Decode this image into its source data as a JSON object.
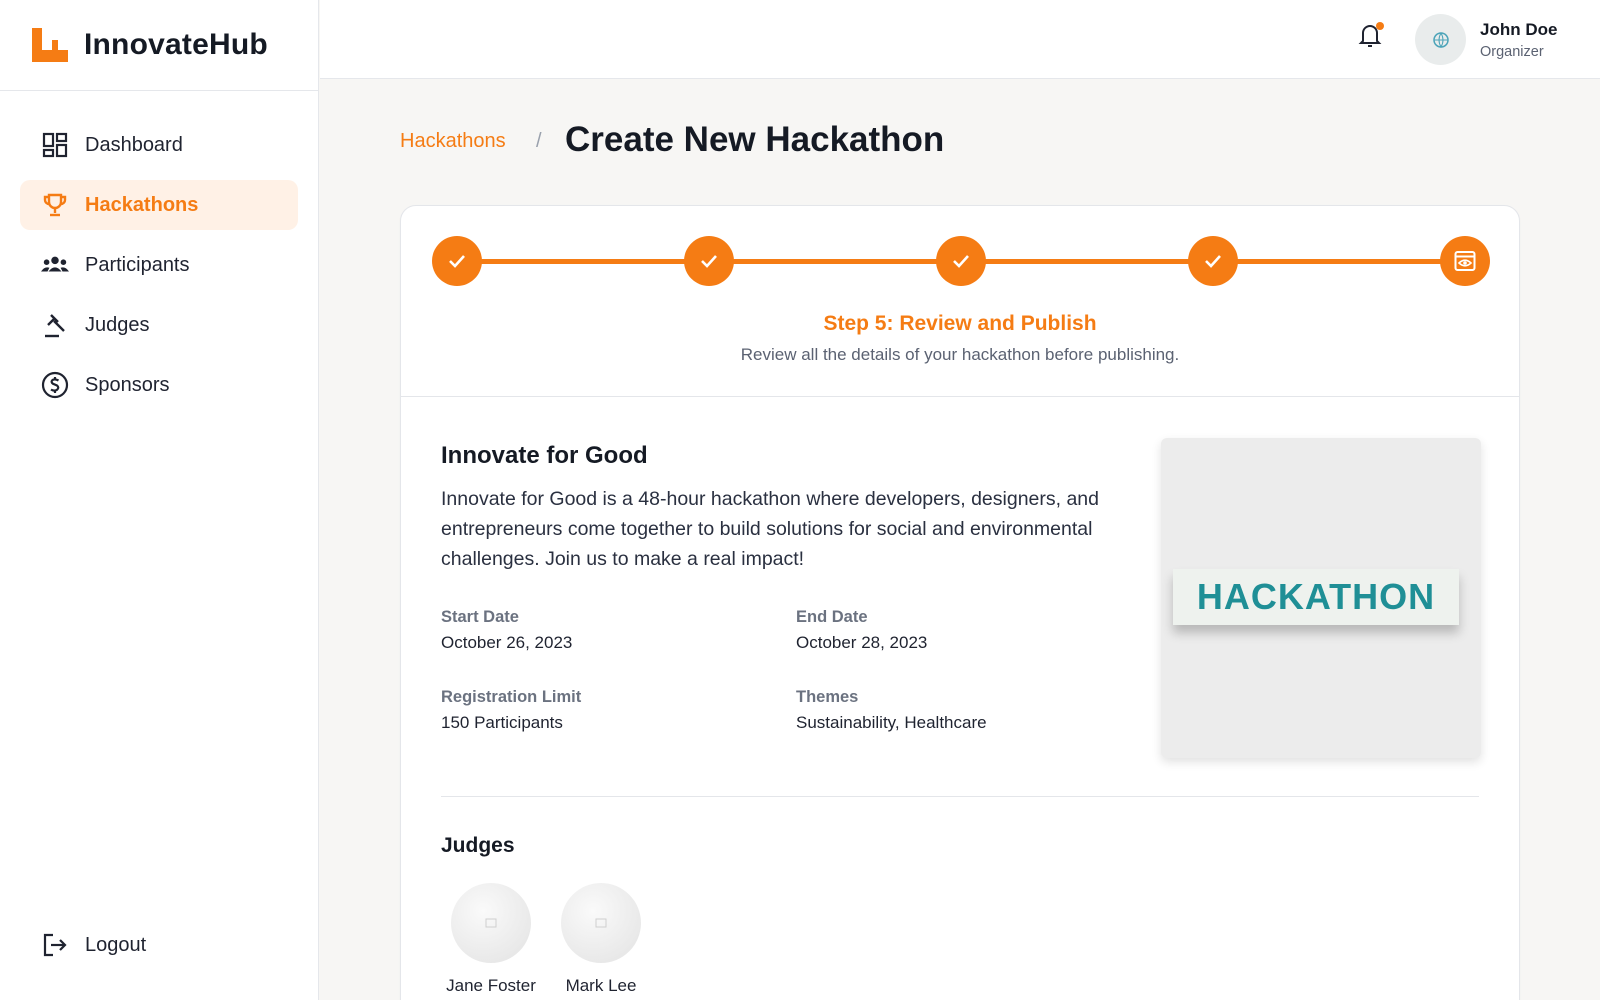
{
  "brand": {
    "name": "InnovateHub"
  },
  "sidebar": {
    "items": [
      {
        "label": "Dashboard",
        "icon": "dashboard-icon"
      },
      {
        "label": "Hackathons",
        "icon": "trophy-icon",
        "active": true
      },
      {
        "label": "Participants",
        "icon": "people-icon"
      },
      {
        "label": "Judges",
        "icon": "gavel-icon"
      },
      {
        "label": "Sponsors",
        "icon": "dollar-icon"
      }
    ],
    "logout_label": "Logout"
  },
  "header": {
    "user_name": "John Doe",
    "user_role": "Organizer"
  },
  "breadcrumb": {
    "parent": "Hackathons",
    "separator": "/",
    "current": "Create New Hackathon"
  },
  "stepper": {
    "current_step": 5,
    "total_steps": 5,
    "title": "Step 5: Review and Publish",
    "subtitle": "Review all the details of your hackathon before publishing."
  },
  "hackathon": {
    "name": "Innovate for Good",
    "description": "Innovate for Good is a 48-hour hackathon where developers, designers, and entrepreneurs come together to build solutions for social and environmental challenges. Join us to make a real impact!",
    "start_date_label": "Start Date",
    "start_date": "October 26, 2023",
    "end_date_label": "End Date",
    "end_date": "October 28, 2023",
    "limit_label": "Registration Limit",
    "limit": "150 Participants",
    "themes_label": "Themes",
    "themes": "Sustainability, Healthcare",
    "cover_text": "HACKATHON"
  },
  "judges": {
    "title": "Judges",
    "list": [
      {
        "name": "Jane Foster"
      },
      {
        "name": "Mark Lee"
      }
    ]
  },
  "colors": {
    "accent": "#f57c14",
    "accent_bg": "#fff1e6",
    "text": "#151a24",
    "muted": "#6b7280",
    "banner_text": "#1f8f96"
  }
}
